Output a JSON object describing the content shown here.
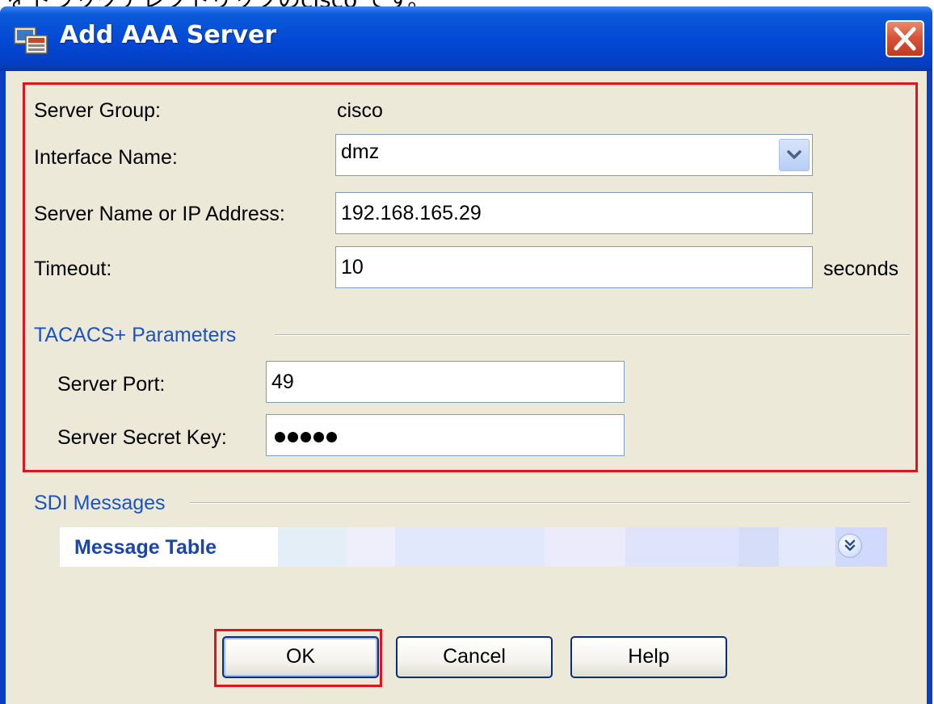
{
  "caption": "をドラッグアレクトリックのcisco です。",
  "window": {
    "title": "Add AAA Server"
  },
  "form": {
    "server_group_label": "Server Group:",
    "server_group_value": "cisco",
    "interface_label": "Interface Name:",
    "interface_value": "dmz",
    "server_name_label": "Server Name or IP Address:",
    "server_name_value": "192.168.165.29",
    "timeout_label": "Timeout:",
    "timeout_value": "10",
    "timeout_unit": "seconds"
  },
  "tacacs": {
    "heading": "TACACS+ Parameters",
    "port_label": "Server Port:",
    "port_value": "49",
    "secret_label": "Server Secret Key:",
    "secret_masked_length": 5
  },
  "sdi": {
    "heading": "SDI Messages",
    "table_title": "Message Table"
  },
  "buttons": {
    "ok": "OK",
    "cancel": "Cancel",
    "help": "Help"
  },
  "colors": {
    "highlight": "#e3131b",
    "section_heading": "#1b52c4",
    "titlebar": "#0348d4",
    "client_bg": "#ece9d8"
  }
}
